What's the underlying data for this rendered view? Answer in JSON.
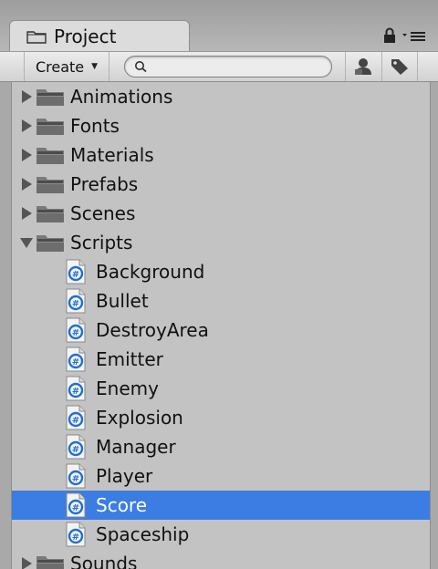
{
  "window": {
    "tab_title": "Project"
  },
  "toolbar": {
    "create_label": "Create",
    "create_arrow": "▼",
    "search_placeholder": "",
    "search_value": ""
  },
  "tree": {
    "items": [
      {
        "label": "Animations",
        "kind": "folder",
        "expanded": false
      },
      {
        "label": "Fonts",
        "kind": "folder",
        "expanded": false
      },
      {
        "label": "Materials",
        "kind": "folder",
        "expanded": false
      },
      {
        "label": "Prefabs",
        "kind": "folder",
        "expanded": false
      },
      {
        "label": "Scenes",
        "kind": "folder",
        "expanded": false
      },
      {
        "label": "Scripts",
        "kind": "folder",
        "expanded": true
      },
      {
        "label": "Background",
        "kind": "script",
        "selected": false
      },
      {
        "label": "Bullet",
        "kind": "script",
        "selected": false
      },
      {
        "label": "DestroyArea",
        "kind": "script",
        "selected": false
      },
      {
        "label": "Emitter",
        "kind": "script",
        "selected": false
      },
      {
        "label": "Enemy",
        "kind": "script",
        "selected": false
      },
      {
        "label": "Explosion",
        "kind": "script",
        "selected": false
      },
      {
        "label": "Manager",
        "kind": "script",
        "selected": false
      },
      {
        "label": "Player",
        "kind": "script",
        "selected": false
      },
      {
        "label": "Score",
        "kind": "script",
        "selected": true
      },
      {
        "label": "Spaceship",
        "kind": "script",
        "selected": false
      },
      {
        "label": "Sounds",
        "kind": "folder",
        "expanded": false
      }
    ]
  },
  "colors": {
    "selection": "#3b7de3",
    "panel_bg": "#c3c3c3",
    "script_icon_accent": "#1f6fd0"
  },
  "icons": {
    "tab": "folder-icon",
    "lock": "lock-icon",
    "menu": "menu-icon",
    "search": "search-icon",
    "filter_type": "filter-by-type-icon",
    "filter_label": "tag-icon",
    "folder": "folder-icon",
    "script": "csharp-script-icon",
    "collapsed": "triangle-right-icon",
    "expanded": "triangle-down-icon"
  }
}
